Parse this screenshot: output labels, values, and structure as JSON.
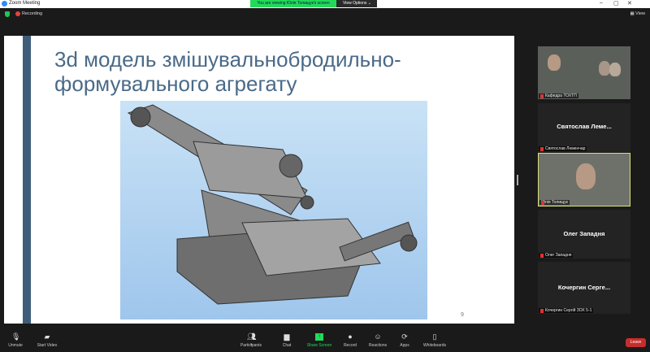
{
  "window": {
    "title": "Zoom Meeting",
    "banner": "You are viewing Юлія Толищук's screen",
    "view_options": "View Options",
    "recording": "Recording",
    "view": "View"
  },
  "slide": {
    "title": "3d модель змішувальнобродильно-формувального агрегату",
    "page": "9"
  },
  "gallery": [
    {
      "display_name": "",
      "label": "Кафедра ТОХТП",
      "type": "video"
    },
    {
      "display_name": "Святослав Леме...",
      "label": "Святослав Леменчар",
      "type": "name"
    },
    {
      "display_name": "",
      "label": "Юлія Толищук",
      "type": "video"
    },
    {
      "display_name": "Олег Западня",
      "label": "Олег Западня",
      "type": "name"
    },
    {
      "display_name": "Кочергин Серге...",
      "label": "Кочергин Сергій ЗОХ 5-1",
      "type": "name"
    }
  ],
  "toolbar": {
    "unmute": "Unmute",
    "start_video": "Start Video",
    "participants": "Participants",
    "participants_count": "5",
    "chat": "Chat",
    "share_screen": "Share Screen",
    "record": "Record",
    "reactions": "Reactions",
    "apps": "Apps",
    "whiteboards": "Whiteboards",
    "leave": "Leave"
  },
  "colors": {
    "share_green": "#23d959",
    "leave_red": "#c72d2d",
    "slide_title": "#4a6a88"
  }
}
